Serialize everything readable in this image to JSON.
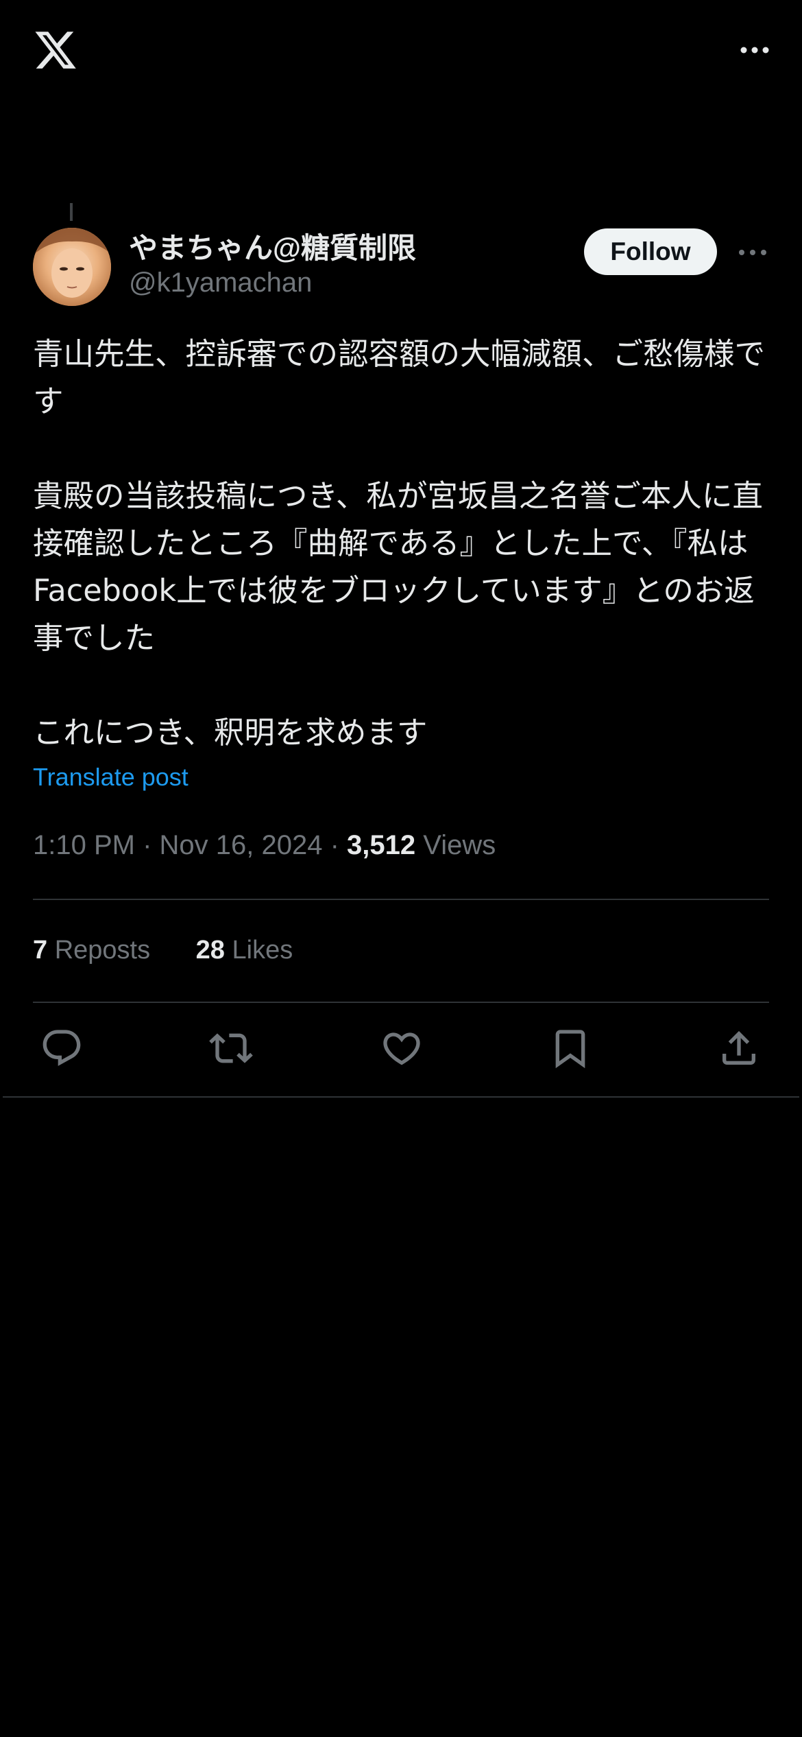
{
  "header": {
    "logo_icon": "x-logo-icon",
    "more_icon": "more-horizontal-icon"
  },
  "author": {
    "display_name": "やまちゃん@糖質制限",
    "handle": "@k1yamachan",
    "follow_label": "Follow"
  },
  "post": {
    "paragraphs": [
      "青山先生、控訴審での認容額の大幅減額、ご愁傷様です",
      "貴殿の当該投稿につき、私が宮坂昌之名誉ご本人に直接確認したところ『曲解である』とした上で、『私はFacebook上では彼をブロックしています』とのお返事でした",
      "これにつき、釈明を求めます"
    ],
    "translate_label": "Translate post"
  },
  "meta": {
    "time": "1:10 PM",
    "separator": " · ",
    "date": "Nov 16, 2024",
    "views_count": "3,512",
    "views_label": "Views"
  },
  "stats": {
    "reposts_count": "7",
    "reposts_label": "Reposts",
    "likes_count": "28",
    "likes_label": "Likes"
  },
  "actions": {
    "reply_icon": "reply-icon",
    "repost_icon": "repost-icon",
    "like_icon": "like-icon",
    "bookmark_icon": "bookmark-icon",
    "share_icon": "share-icon"
  },
  "colors": {
    "background": "#000000",
    "text_primary": "#e7e9ea",
    "text_secondary": "#71767b",
    "link": "#1d9bf0",
    "divider": "#2f3336",
    "follow_bg": "#eff3f4"
  }
}
